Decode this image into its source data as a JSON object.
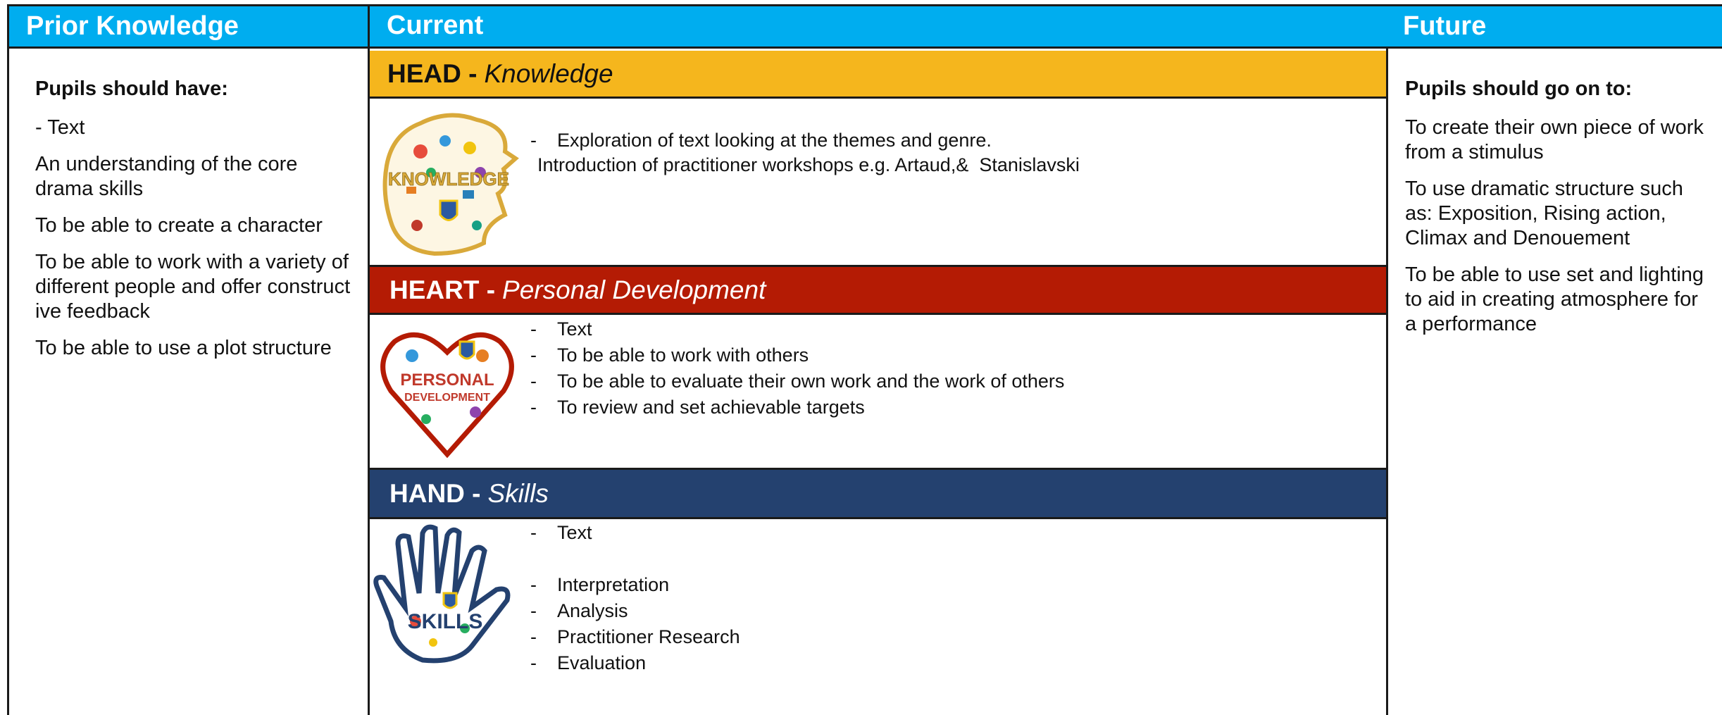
{
  "prior": {
    "title": "Prior Knowledge",
    "lead": "Pupils should have:",
    "items": [
      "- Text",
      "An understanding of the core drama skills",
      "To be able to create a character",
      "To be able to work with a variety of different people and offer constructive feedback",
      "To be able to use a plot structure"
    ]
  },
  "current": {
    "title": "Current",
    "head": {
      "label": "HEAD -",
      "subtitle": "Knowledge",
      "emblem_text": "KNOWLEDGE",
      "items": [
        "Exploration of text looking at the themes and genre.",
        "Introduction of practitioner workshops e.g. Artaud,&  Stanislavski"
      ]
    },
    "heart": {
      "label": "HEART -",
      "subtitle": "Personal Development",
      "emblem_text_1": "PERSONAL",
      "emblem_text_2": "DEVELOPMENT",
      "items": [
        "Text",
        "To be able to work with others",
        "To be able to evaluate their own work and the work of others",
        "To review and set achievable targets"
      ]
    },
    "hand": {
      "label": "HAND -",
      "subtitle": "Skills",
      "emblem_text": "SKILLS",
      "items": [
        "Text",
        "Interpretation",
        "Analysis",
        "Practitioner Research",
        "Evaluation"
      ]
    }
  },
  "future": {
    "title": "Future",
    "lead": "Pupils should go on to:",
    "items": [
      "To create their own piece of work from a stimulus",
      "To use dramatic structure such as: Exposition, Rising action, Climax and Denouement",
      "To be able to use set and lighting to aid in creating atmosphere for a performance"
    ]
  },
  "colors": {
    "header_blue": "#00adef",
    "head_yellow": "#f5b61d",
    "heart_red": "#b41b04",
    "hand_navy": "#24416f"
  }
}
